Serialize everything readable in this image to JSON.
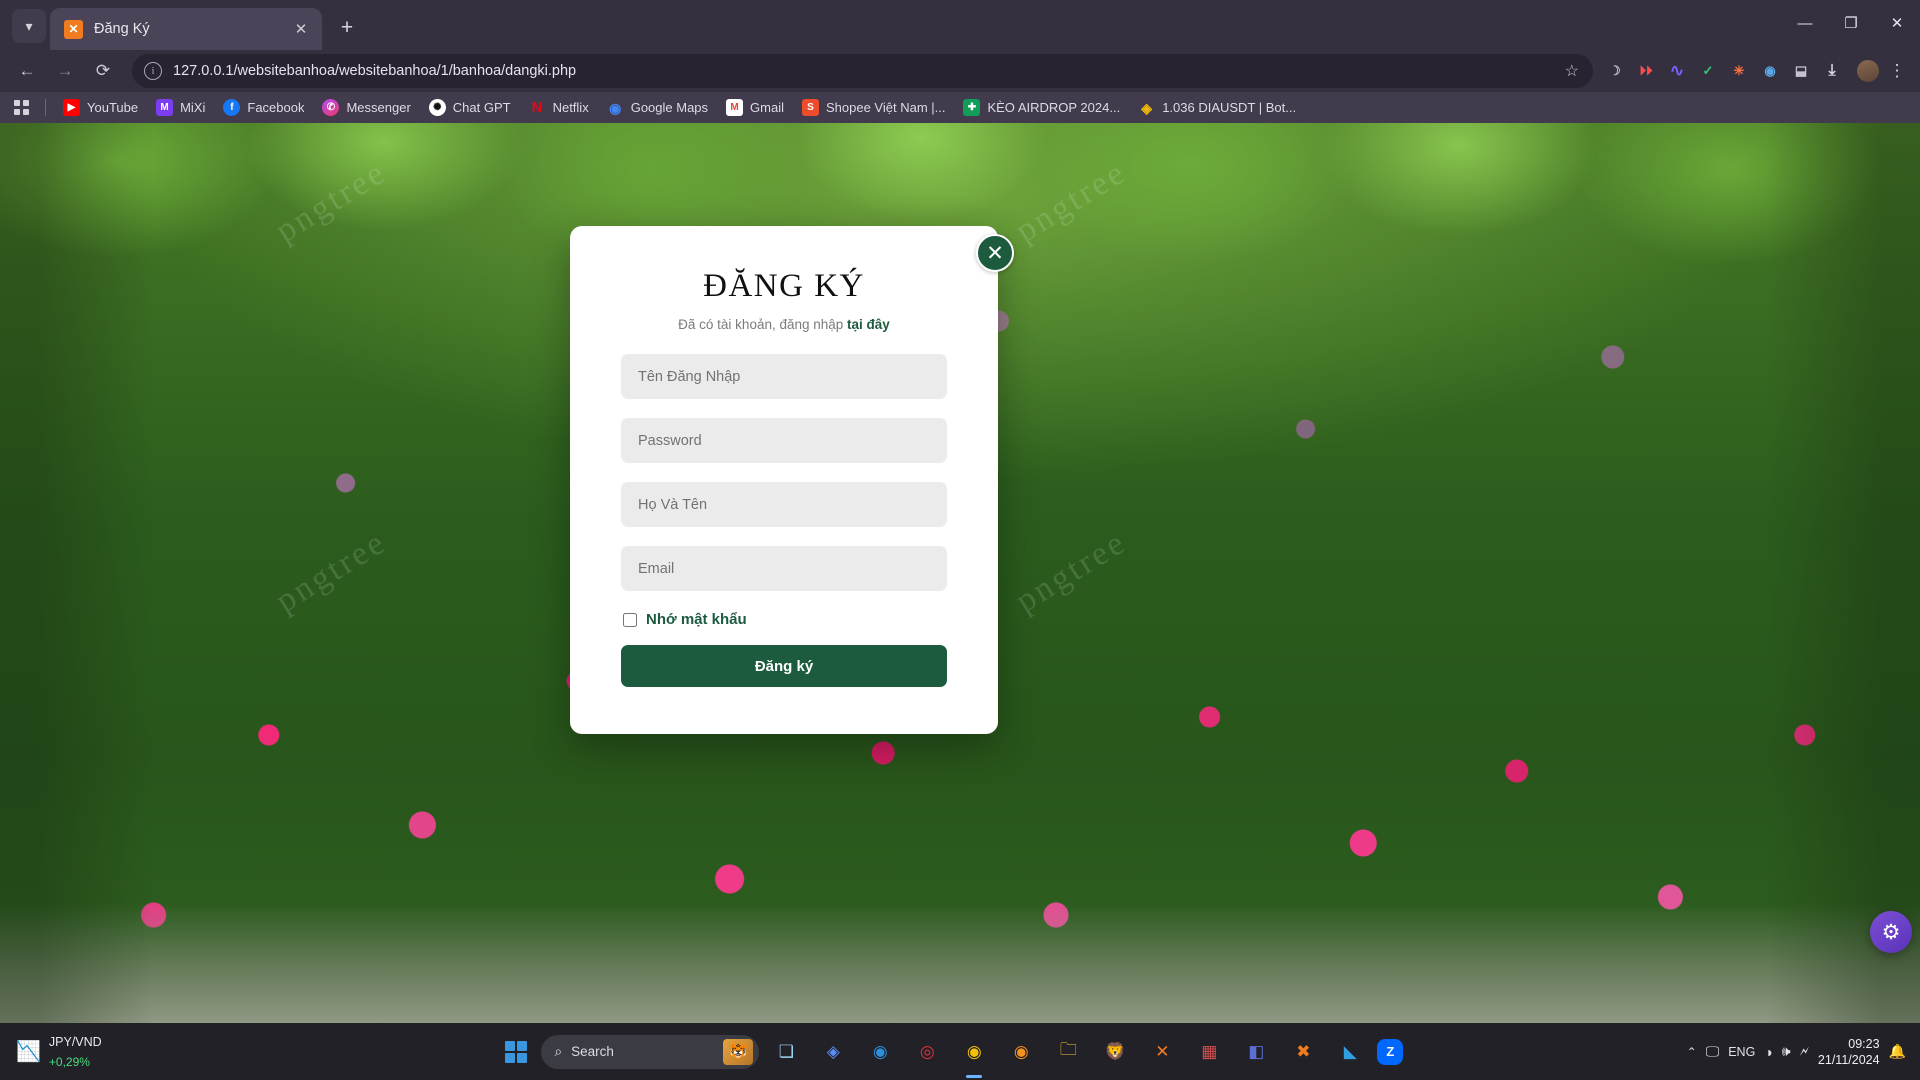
{
  "window": {
    "minimize_label": "—",
    "maximize_label": "❐",
    "close_label": "✕"
  },
  "tabstrip": {
    "tab_search_icon": "chevron-down-icon",
    "tab": {
      "favicon": "xampp-favicon",
      "favicon_glyph": "✕",
      "title": "Đăng Ký",
      "close_label": "✕"
    },
    "new_tab_label": "+"
  },
  "toolbar": {
    "back_label": "←",
    "forward_label": "→",
    "reload_label": "⟳",
    "info_label": "i",
    "url": "127.0.0.1/websitebanhoa/websitebanhoa/1/banhoa/dangki.php",
    "bookmark_star_label": "☆",
    "extensions": [
      {
        "name": "moon-reader-icon",
        "glyph": "☽",
        "color": "#b9b4c6"
      },
      {
        "name": "video-downloader-icon",
        "glyph": "⏵⏵",
        "color": "#ff4d4d"
      },
      {
        "name": "analytics-icon",
        "glyph": "∿",
        "color": "#7c5cff"
      },
      {
        "name": "shield-icon",
        "glyph": "✓",
        "color": "#2ecc71"
      },
      {
        "name": "star-burst-icon",
        "glyph": "✳",
        "color": "#ff7043"
      },
      {
        "name": "circle-dot-icon",
        "glyph": "◉",
        "color": "#5aa9e6"
      },
      {
        "name": "puzzle-icon",
        "glyph": "⬓",
        "color": "#c6c2cf"
      }
    ],
    "download_label": "⤓",
    "profile_name": "avatar",
    "menu_label": "⋮"
  },
  "bookmarks": {
    "apps_icon": "apps-grid-icon",
    "items": [
      {
        "label": "YouTube",
        "icon": "youtube-icon",
        "glyph": "▶",
        "color": "#ff0000"
      },
      {
        "label": "MiXi",
        "icon": "mixi-icon",
        "glyph": "M",
        "color": "#7a3df0"
      },
      {
        "label": "Facebook",
        "icon": "facebook-icon",
        "glyph": "f",
        "color": "#1877f2"
      },
      {
        "label": "Messenger",
        "icon": "messenger-icon",
        "glyph": "✆",
        "color": "#e0379a"
      },
      {
        "label": "Chat GPT",
        "icon": "chatgpt-icon",
        "glyph": "✺",
        "color": "#ffffff"
      },
      {
        "label": "Netflix",
        "icon": "netflix-icon",
        "glyph": "N",
        "color": "#e50914"
      },
      {
        "label": "Google Maps",
        "icon": "googlemaps-icon",
        "glyph": "◉",
        "color": "#4285f4"
      },
      {
        "label": "Gmail",
        "icon": "gmail-icon",
        "glyph": "M",
        "color": "#ea4335"
      },
      {
        "label": "Shopee Việt Nam |...",
        "icon": "shopee-icon",
        "glyph": "S",
        "color": "#ee4d2d"
      },
      {
        "label": "KÈO AIRDROP 2024...",
        "icon": "sheets-icon",
        "glyph": "✚",
        "color": "#0f9d58"
      },
      {
        "label": "1.036 DIAUSDT | Bot...",
        "icon": "binance-icon",
        "glyph": "◈",
        "color": "#f0b90b"
      }
    ]
  },
  "page": {
    "watermark": "pngtree",
    "modal": {
      "title": "ĐĂNG KÝ",
      "close_label": "✕",
      "subtitle_text": "Đã có tài khoản, đăng nhập ",
      "subtitle_link": "tại đây",
      "fields": [
        {
          "name": "username-input",
          "placeholder": "Tên Đăng Nhập",
          "value": "",
          "type": "text"
        },
        {
          "name": "password-input",
          "placeholder": "Password",
          "value": "",
          "type": "password"
        },
        {
          "name": "fullname-input",
          "placeholder": "Họ Và Tên",
          "value": "",
          "type": "text"
        },
        {
          "name": "email-input",
          "placeholder": "Email",
          "value": "",
          "type": "text"
        }
      ],
      "remember_label": "Nhớ mật khẩu",
      "remember_checked": false,
      "submit_label": "Đăng ký",
      "accent_color": "#1d5b3f",
      "field_background": "#ebebeb"
    },
    "float_widget_icon": "gear-icon",
    "float_widget_glyph": "⚙"
  },
  "taskbar": {
    "widget": {
      "icon": "chart-widget-icon",
      "glyph": "📉",
      "pair": "JPY/VND",
      "change": "+0,29%"
    },
    "start_label": "start-button",
    "search_placeholder": "Search",
    "search_icon": "search-icon",
    "search_thumb": "tiger-thumbnail",
    "apps": [
      {
        "name": "task-view",
        "glyph": "❏",
        "color": "#9fd4f5",
        "active": false
      },
      {
        "name": "copilot",
        "glyph": "◈",
        "color": "#5b8df5",
        "active": false
      },
      {
        "name": "edge",
        "glyph": "◉",
        "color": "#2f8fd8",
        "active": false
      },
      {
        "name": "opera-gx",
        "glyph": "◎",
        "color": "#e8313a",
        "active": false
      },
      {
        "name": "chrome",
        "glyph": "◉",
        "color": "#f4c20d",
        "active": true
      },
      {
        "name": "ultraviewer",
        "glyph": "◉",
        "color": "#f5911e",
        "active": false
      },
      {
        "name": "file-explorer",
        "glyph": "🗀",
        "color": "#ffca28",
        "active": false
      },
      {
        "name": "brave",
        "glyph": "🦁",
        "color": "#fb542b",
        "active": false
      },
      {
        "name": "xampp",
        "glyph": "✕",
        "color": "#f07c1f",
        "active": false
      },
      {
        "name": "app-store",
        "glyph": "▦",
        "color": "#d94f4f",
        "active": false
      },
      {
        "name": "teams",
        "glyph": "◧",
        "color": "#5b6fd6",
        "active": false
      },
      {
        "name": "xampp-control",
        "glyph": "✖",
        "color": "#ef7c20",
        "active": false
      },
      {
        "name": "vs-code",
        "glyph": "◣",
        "color": "#2f9fe0",
        "active": false
      },
      {
        "name": "zalo",
        "glyph": "Z",
        "color": "#0068ff",
        "active": false
      }
    ],
    "tray": {
      "chevron": "⌃",
      "display_icon": "🖵",
      "language": "ENG",
      "wifi_icon": "◑",
      "volume_icon": "🕪",
      "battery_icon": "🗲",
      "time": "09:23",
      "date": "21/11/2024",
      "notification_icon": "🔔"
    }
  }
}
